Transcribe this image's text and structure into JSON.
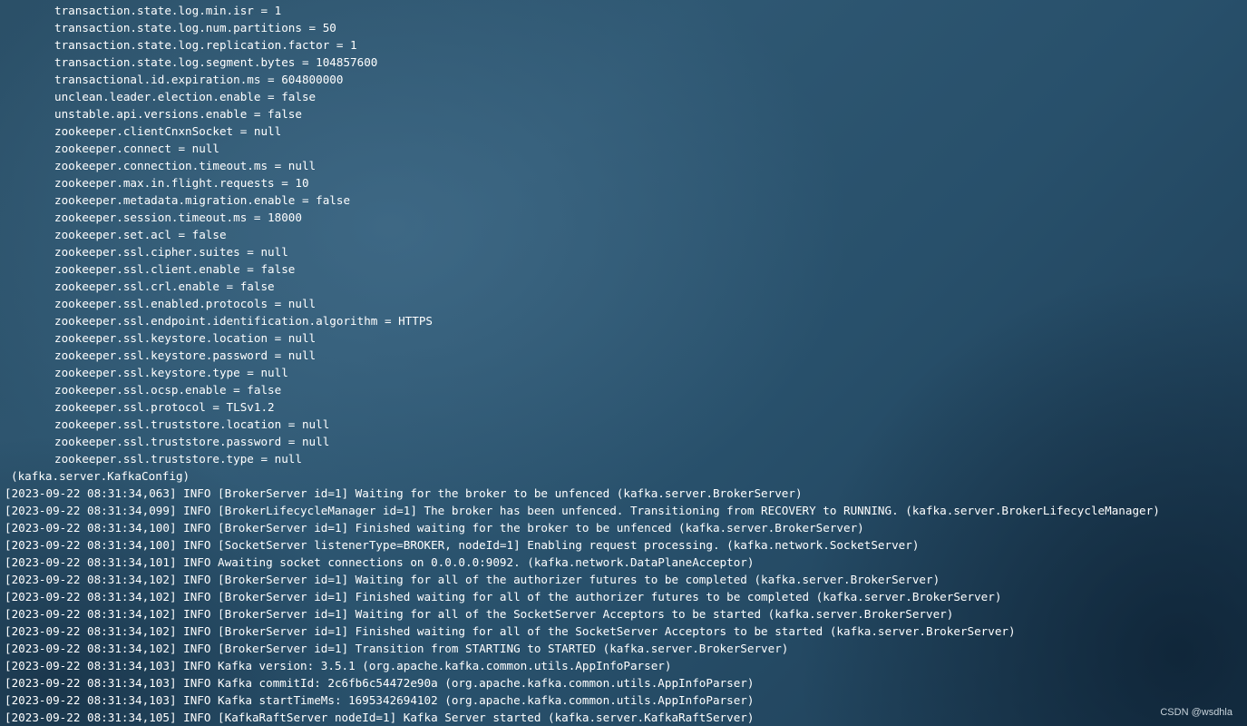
{
  "terminal": {
    "config_lines": [
      "transaction.state.log.min.isr = 1",
      "transaction.state.log.num.partitions = 50",
      "transaction.state.log.replication.factor = 1",
      "transaction.state.log.segment.bytes = 104857600",
      "transactional.id.expiration.ms = 604800000",
      "unclean.leader.election.enable = false",
      "unstable.api.versions.enable = false",
      "zookeeper.clientCnxnSocket = null",
      "zookeeper.connect = null",
      "zookeeper.connection.timeout.ms = null",
      "zookeeper.max.in.flight.requests = 10",
      "zookeeper.metadata.migration.enable = false",
      "zookeeper.session.timeout.ms = 18000",
      "zookeeper.set.acl = false",
      "zookeeper.ssl.cipher.suites = null",
      "zookeeper.ssl.client.enable = false",
      "zookeeper.ssl.crl.enable = false",
      "zookeeper.ssl.enabled.protocols = null",
      "zookeeper.ssl.endpoint.identification.algorithm = HTTPS",
      "zookeeper.ssl.keystore.location = null",
      "zookeeper.ssl.keystore.password = null",
      "zookeeper.ssl.keystore.type = null",
      "zookeeper.ssl.ocsp.enable = false",
      "zookeeper.ssl.protocol = TLSv1.2",
      "zookeeper.ssl.truststore.location = null",
      "zookeeper.ssl.truststore.password = null",
      "zookeeper.ssl.truststore.type = null"
    ],
    "config_close": "(kafka.server.KafkaConfig)",
    "log_lines": [
      "[2023-09-22 08:31:34,063] INFO [BrokerServer id=1] Waiting for the broker to be unfenced (kafka.server.BrokerServer)",
      "[2023-09-22 08:31:34,099] INFO [BrokerLifecycleManager id=1] The broker has been unfenced. Transitioning from RECOVERY to RUNNING. (kafka.server.BrokerLifecycleManager)",
      "[2023-09-22 08:31:34,100] INFO [BrokerServer id=1] Finished waiting for the broker to be unfenced (kafka.server.BrokerServer)",
      "[2023-09-22 08:31:34,100] INFO [SocketServer listenerType=BROKER, nodeId=1] Enabling request processing. (kafka.network.SocketServer)",
      "[2023-09-22 08:31:34,101] INFO Awaiting socket connections on 0.0.0.0:9092. (kafka.network.DataPlaneAcceptor)",
      "[2023-09-22 08:31:34,102] INFO [BrokerServer id=1] Waiting for all of the authorizer futures to be completed (kafka.server.BrokerServer)",
      "[2023-09-22 08:31:34,102] INFO [BrokerServer id=1] Finished waiting for all of the authorizer futures to be completed (kafka.server.BrokerServer)",
      "[2023-09-22 08:31:34,102] INFO [BrokerServer id=1] Waiting for all of the SocketServer Acceptors to be started (kafka.server.BrokerServer)",
      "[2023-09-22 08:31:34,102] INFO [BrokerServer id=1] Finished waiting for all of the SocketServer Acceptors to be started (kafka.server.BrokerServer)",
      "[2023-09-22 08:31:34,102] INFO [BrokerServer id=1] Transition from STARTING to STARTED (kafka.server.BrokerServer)",
      "[2023-09-22 08:31:34,103] INFO Kafka version: 3.5.1 (org.apache.kafka.common.utils.AppInfoParser)",
      "[2023-09-22 08:31:34,103] INFO Kafka commitId: 2c6fb6c54472e90a (org.apache.kafka.common.utils.AppInfoParser)",
      "[2023-09-22 08:31:34,103] INFO Kafka startTimeMs: 1695342694102 (org.apache.kafka.common.utils.AppInfoParser)",
      "[2023-09-22 08:31:34,105] INFO [KafkaRaftServer nodeId=1] Kafka Server started (kafka.server.KafkaRaftServer)"
    ]
  },
  "watermark": "CSDN @wsdhla"
}
